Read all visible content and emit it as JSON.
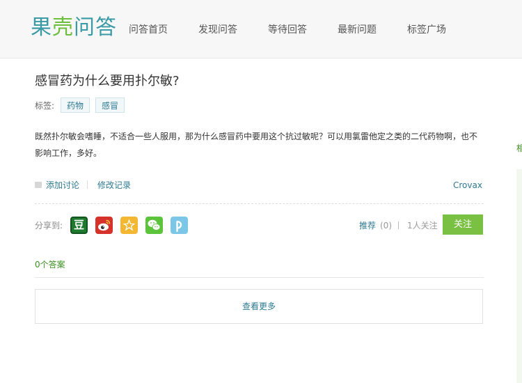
{
  "logo": {
    "part1": "果",
    "part2": "壳",
    "part3": "问答"
  },
  "nav": [
    "问答首页",
    "发现问答",
    "等待回答",
    "最新问题",
    "标签广场"
  ],
  "question": {
    "title": "感冒药为什么要用扑尔敏?",
    "tags_label": "标签:",
    "tags": [
      "药物",
      "感冒"
    ],
    "content": "既然扑尔敏会嗜睡，不适合一些人服用，那为什么感冒药中要用这个抗过敏呢？可以用氯雷他定之类的二代药物啊，也不影响工作，多好。"
  },
  "actions": {
    "add_discussion": "添加讨论",
    "edit_history": "修改记录",
    "author": "Crovax"
  },
  "share": {
    "label": "分享到:",
    "icons": [
      "douban-icon",
      "weibo-icon",
      "qzone-star-icon",
      "wechat-icon",
      "pinterest-icon"
    ],
    "douban_glyph": "豆"
  },
  "stats": {
    "recommend": "推荐",
    "recommend_count": "(0)",
    "followers": "1人关注",
    "follow_button": "关注"
  },
  "answers": {
    "count_label": "0个答案",
    "more": "查看更多"
  },
  "sidebar": {
    "partial_label": "相"
  },
  "colors": {
    "accent_green": "#7ac143",
    "link_blue": "#2d7a92",
    "logo_teal": "#3a9aa6",
    "logo_green": "#6dbe3b"
  }
}
